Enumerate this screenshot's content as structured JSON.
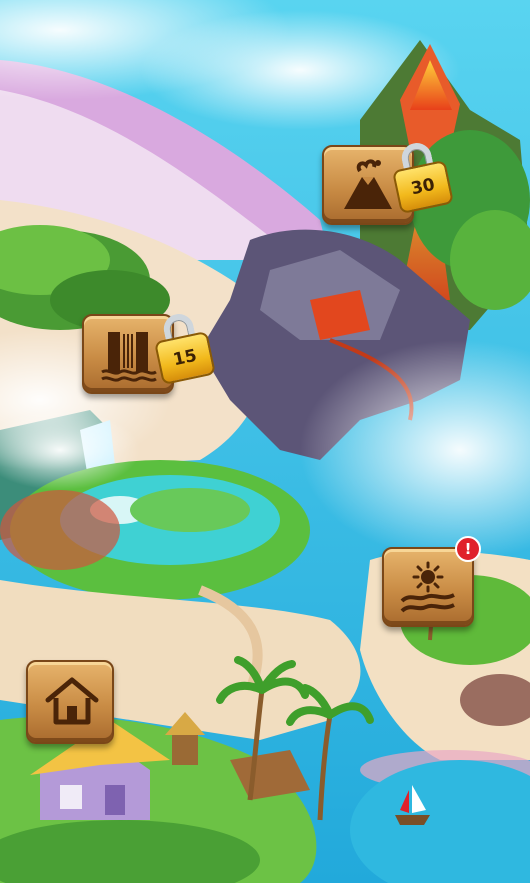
{
  "levels": [
    {
      "id": "volcano",
      "icon": "volcano-icon",
      "locked": true,
      "unlock_level": "30"
    },
    {
      "id": "waterfall",
      "icon": "waterfall-icon",
      "locked": true,
      "unlock_level": "15"
    },
    {
      "id": "beach",
      "icon": "beach-sun-icon",
      "locked": false,
      "alert": "!"
    },
    {
      "id": "home",
      "icon": "home-icon",
      "locked": false
    }
  ],
  "colors": {
    "sea": "#3fc6e6",
    "wood": "#c98c45",
    "lock_gold": "#f2b91c",
    "alert_red": "#e0212b",
    "lava": "#f0561a"
  }
}
